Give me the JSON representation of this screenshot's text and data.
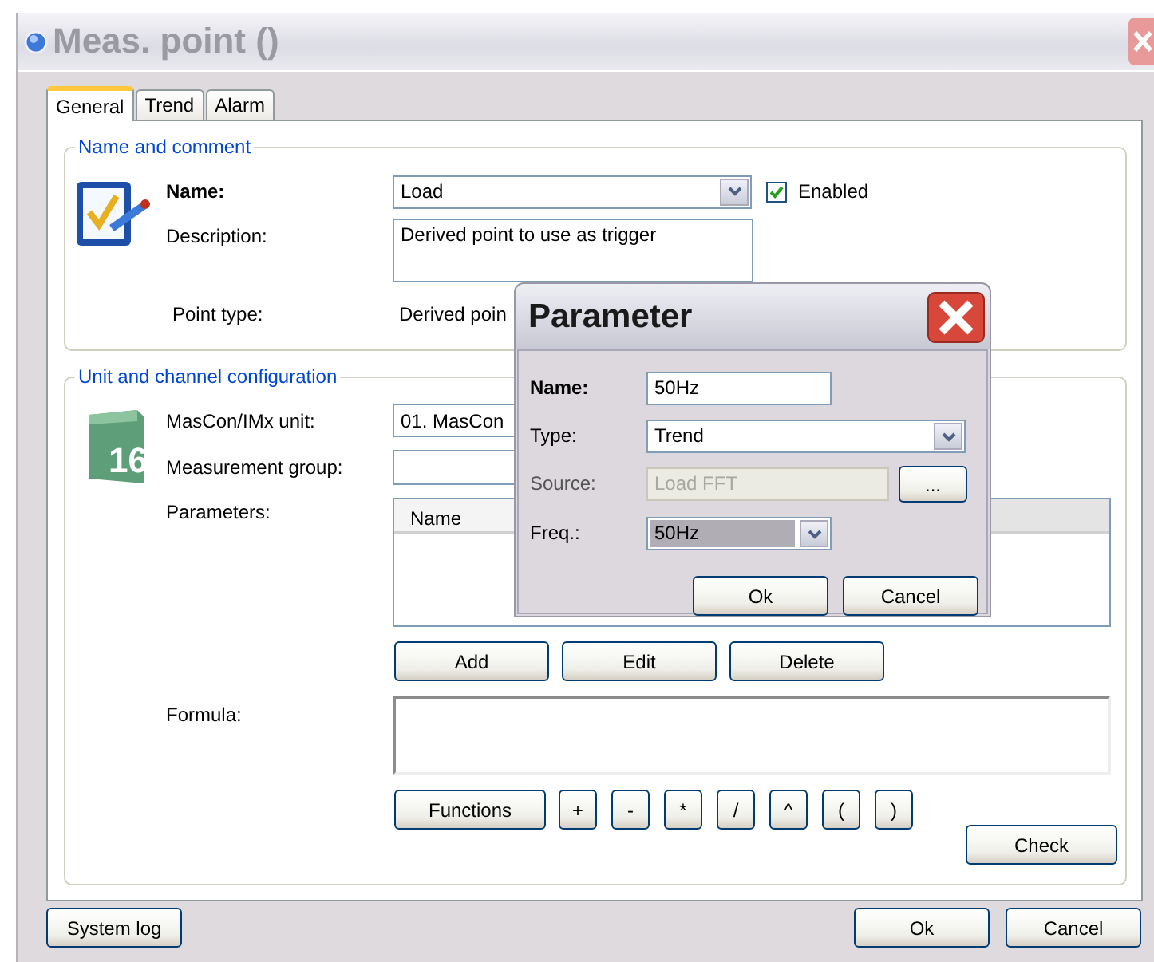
{
  "window": {
    "title": "Meas. point ()"
  },
  "tabs": [
    {
      "label": "General",
      "selected": true
    },
    {
      "label": "Trend",
      "selected": false
    },
    {
      "label": "Alarm",
      "selected": false
    }
  ],
  "name_and_comment": {
    "legend": "Name and comment",
    "name": {
      "label": "Name:",
      "value": "Load"
    },
    "enabled": {
      "label": "Enabled",
      "checked": true
    },
    "description": {
      "label": "Description:",
      "value": "Derived point to use as trigger"
    },
    "point_type": {
      "label": "Point type:",
      "value": "Derived poin"
    }
  },
  "unit_config": {
    "legend": "Unit and channel configuration",
    "icon_label": "16",
    "unit": {
      "label": "MasCon/IMx unit:",
      "value": "01. MasCon"
    },
    "measurement_group": {
      "label": "Measurement group:"
    },
    "parameters": {
      "label": "Parameters:",
      "columns": [
        "Name"
      ]
    },
    "buttons": [
      "Add",
      "Edit",
      "Delete"
    ],
    "formula": {
      "label": "Formula:"
    },
    "formula_buttons": [
      "Functions",
      "+",
      "-",
      "*",
      "/",
      "^",
      "(",
      ")"
    ],
    "check_button": "Check"
  },
  "footer": {
    "system_log": "System log",
    "buttons": [
      "Ok",
      "Cancel"
    ]
  },
  "dialog": {
    "title": "Parameter",
    "fields": [
      {
        "kind": "text",
        "label": "Name:",
        "bold": true,
        "value": "50Hz",
        "disabled": false,
        "highlighted": false
      },
      {
        "kind": "combo",
        "label": "Type:",
        "bold": false,
        "value": "Trend",
        "disabled": false,
        "highlighted": false
      },
      {
        "kind": "browse",
        "label": "Source:",
        "bold": false,
        "value": "Load FFT",
        "disabled": true,
        "highlighted": false,
        "button": "..."
      },
      {
        "kind": "combo",
        "label": "Freq.:",
        "bold": false,
        "value": "50Hz",
        "disabled": false,
        "highlighted": true
      }
    ],
    "buttons": [
      "Ok",
      "Cancel"
    ]
  }
}
